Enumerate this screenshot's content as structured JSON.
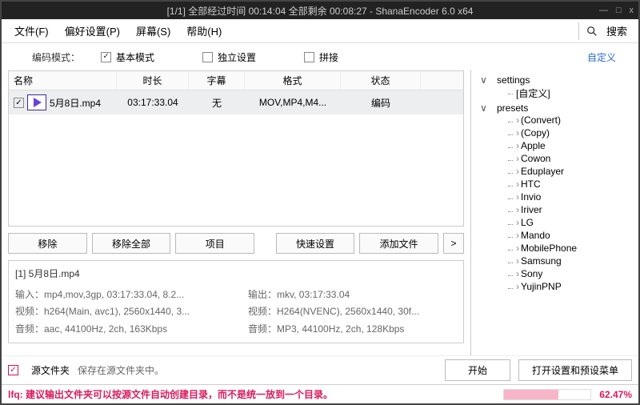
{
  "title": "[1/1] 全部经过时间  00:14:04 全部剩余  00:08:27  - ShanaEncoder  6.0  x64",
  "window_buttons": {
    "min": "—",
    "max": "□",
    "close": "x"
  },
  "menu": {
    "file": "文件(F)",
    "pref": "偏好设置(P)",
    "screen": "屏幕(S)",
    "help": "帮助(H)",
    "search": "搜索"
  },
  "encode_mode_label": "编码模式：",
  "modes": {
    "basic": "基本模式",
    "indep": "独立设置",
    "concat": "拼接"
  },
  "custom_link": "自定义",
  "table": {
    "headers": {
      "name": "名称",
      "duration": "时长",
      "subtitle": "字幕",
      "format": "格式",
      "status": "状态"
    },
    "rows": [
      {
        "name": "5月8日.mp4",
        "duration": "03:17:33.04",
        "subtitle": "无",
        "format": "MOV,MP4,M4...",
        "status": "编码"
      }
    ]
  },
  "buttons": {
    "remove": "移除",
    "remove_all": "移除全部",
    "project": "项目",
    "quick_set": "快速设置",
    "add_file": "添加文件",
    "next": ">"
  },
  "info": {
    "title": "[1] 5月8日.mp4",
    "in_container": "输入：mp4,mov,3gp, 03:17:33.04, 8.2...",
    "in_video": "视频：h264(Main, avc1), 2560x1440, 3...",
    "in_audio": "音频：aac, 44100Hz, 2ch, 163Kbps",
    "out_container": "输出：mkv, 03:17:33.04",
    "out_video": "视频：H264(NVENC), 2560x1440, 30f...",
    "out_audio": "音频：MP3, 44100Hz, 2ch, 128Kbps"
  },
  "bottom": {
    "src_folder": "源文件夹",
    "save_in_src": "保存在源文件夹中。",
    "start": "开始",
    "open_settings": "打开设置和预设菜单"
  },
  "status": {
    "text": "lfq: 建议输出文件夹可以按源文件自动创建目录，而不是统一放到一个目录。",
    "percent": "62.47%",
    "progress_width": 62.47
  },
  "tree": {
    "settings": {
      "label": "settings",
      "children": [
        "[自定义]"
      ]
    },
    "presets": {
      "label": "presets",
      "children": [
        "(Convert)",
        "(Copy)",
        "Apple",
        "Cowon",
        "Eduplayer",
        "HTC",
        "Invio",
        "Iriver",
        "LG",
        "Mando",
        "MobilePhone",
        "Samsung",
        "Sony",
        "YujinPNP"
      ]
    }
  }
}
